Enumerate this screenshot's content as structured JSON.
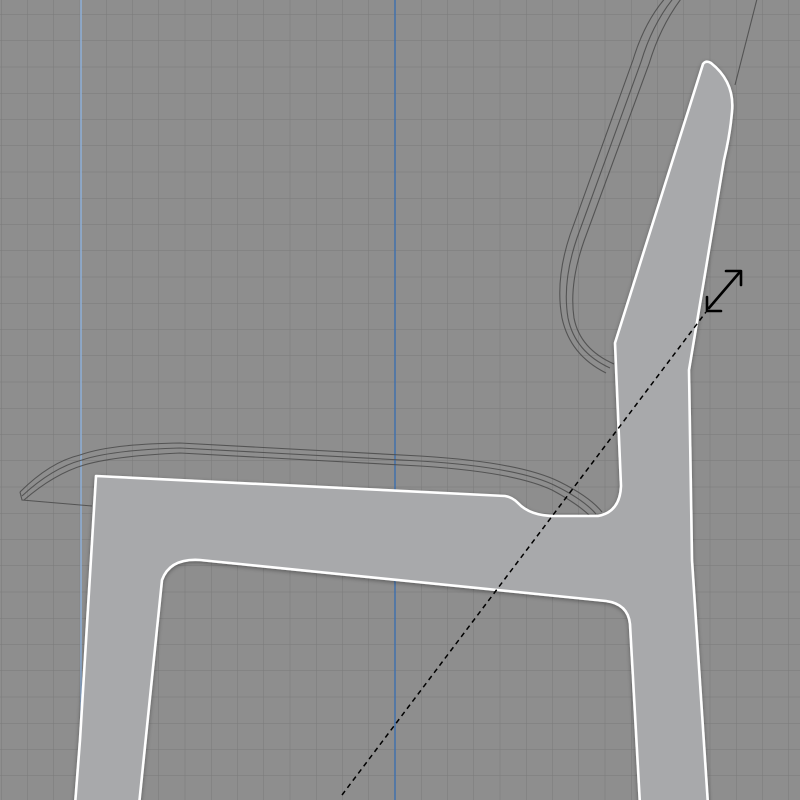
{
  "viewport": {
    "background_color": "#8e8e8e",
    "grid_color": "#7a7a7a",
    "grid_major_color": "#707070",
    "guide_colors": [
      "#7fa6d6",
      "#3c6fb0"
    ]
  },
  "model": {
    "fill_color": "#a8a9ab",
    "outline_color": "#ffffff",
    "ghost_color": "#4a4a4a"
  },
  "manipulator": {
    "icon": "double-arrow-icon",
    "color": "#000000",
    "axis_style": "dashed"
  }
}
